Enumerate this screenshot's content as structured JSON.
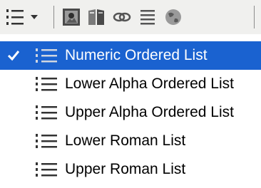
{
  "toolbar": {
    "buttons": [
      {
        "icon": "ordered-list-icon"
      },
      {
        "icon": "dropdown-arrow-icon"
      },
      {
        "icon": "image-icon"
      },
      {
        "icon": "book-icon"
      },
      {
        "icon": "link-icon"
      },
      {
        "icon": "text-align-icon"
      },
      {
        "icon": "globe-icon"
      }
    ]
  },
  "menu": {
    "items": [
      {
        "label": "Numeric Ordered List",
        "icon": "numeric-list-icon",
        "selected": true
      },
      {
        "label": "Lower Alpha Ordered List",
        "icon": "lower-alpha-list-icon",
        "selected": false
      },
      {
        "label": "Upper Alpha Ordered List",
        "icon": "upper-alpha-list-icon",
        "selected": false
      },
      {
        "label": "Lower Roman List",
        "icon": "lower-roman-list-icon",
        "selected": false
      },
      {
        "label": "Upper Roman List",
        "icon": "upper-roman-list-icon",
        "selected": false
      }
    ]
  },
  "colors": {
    "selection": "#1a62d0",
    "toolbar_bg": "#f0f0ee"
  }
}
